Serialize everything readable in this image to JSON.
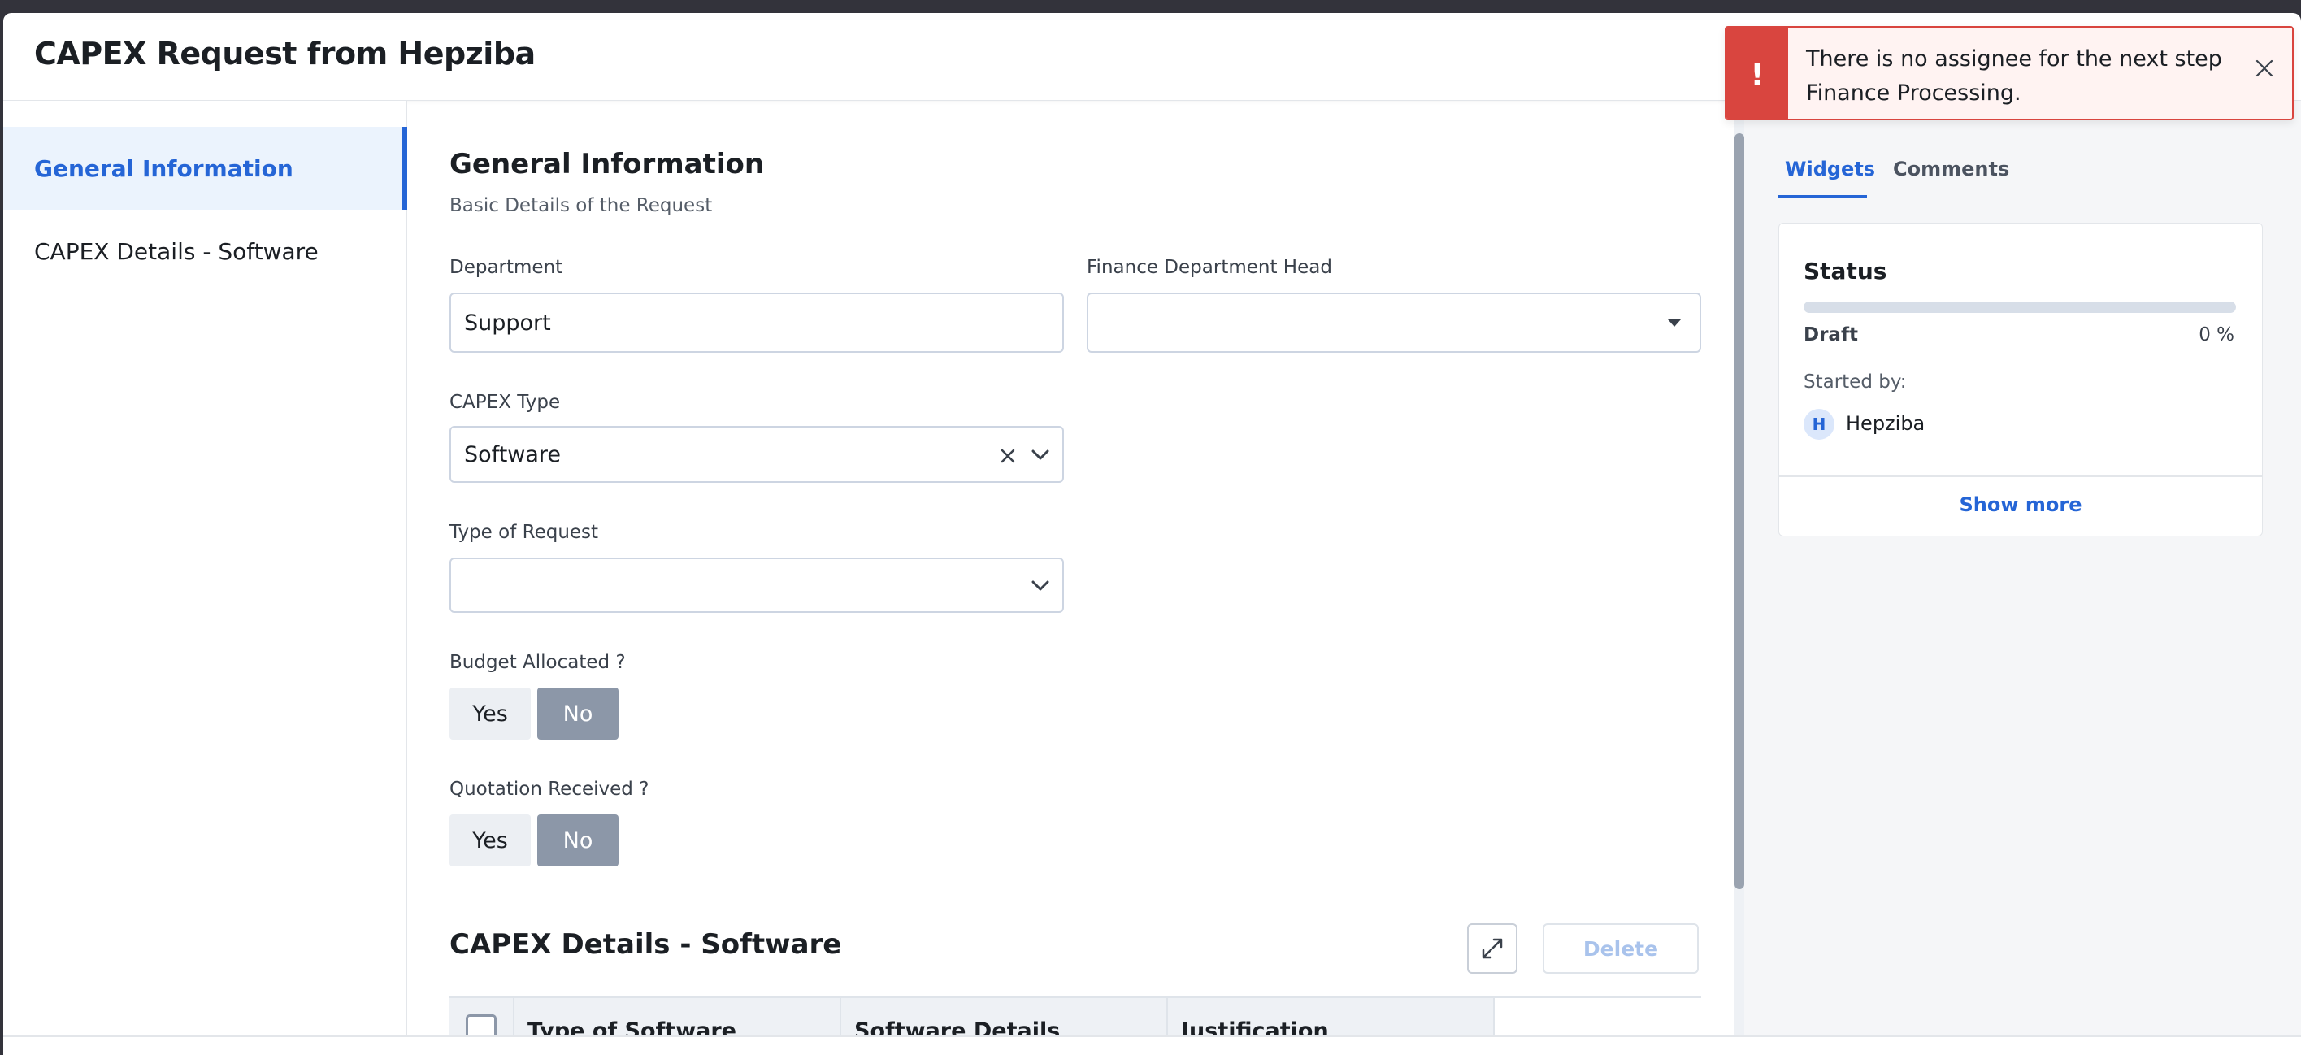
{
  "modal": {
    "title": "CAPEX Request from Hepziba"
  },
  "left_nav": {
    "items": [
      {
        "label": "General Information",
        "active": true
      },
      {
        "label": "CAPEX Details - Software",
        "active": false
      }
    ]
  },
  "form": {
    "section_title": "General Information",
    "section_subtitle": "Basic Details of the Request",
    "department": {
      "label": "Department",
      "value": "Support"
    },
    "finance_head": {
      "label": "Finance Department Head",
      "value": ""
    },
    "capex_type": {
      "label": "CAPEX Type",
      "value": "Software"
    },
    "type_of_request": {
      "label": "Type of Request",
      "value": ""
    },
    "budget_allocated": {
      "label": "Budget Allocated ?",
      "yes": "Yes",
      "no": "No",
      "selected": "No"
    },
    "quotation_received": {
      "label": "Quotation Received ?",
      "yes": "Yes",
      "no": "No",
      "selected": "No"
    }
  },
  "capex_details": {
    "title": "CAPEX Details - Software",
    "delete_label": "Delete",
    "columns": [
      "Type of Software",
      "Software Details",
      "Justification"
    ]
  },
  "right_panel": {
    "tabs": [
      {
        "label": "Widgets",
        "active": true
      },
      {
        "label": "Comments",
        "active": false
      }
    ],
    "status": {
      "title": "Status",
      "state": "Draft",
      "percent_label": "0 %",
      "progress": 0,
      "started_by_label": "Started by:",
      "avatar_initial": "H",
      "started_by_name": "Hepziba",
      "show_more": "Show more"
    }
  },
  "toast": {
    "icon": "!",
    "message": "There is no assignee for the next step Finance Processing."
  },
  "colors": {
    "accent": "#2565d6",
    "error": "#d9453f",
    "selected_segment": "#8c97a8"
  }
}
